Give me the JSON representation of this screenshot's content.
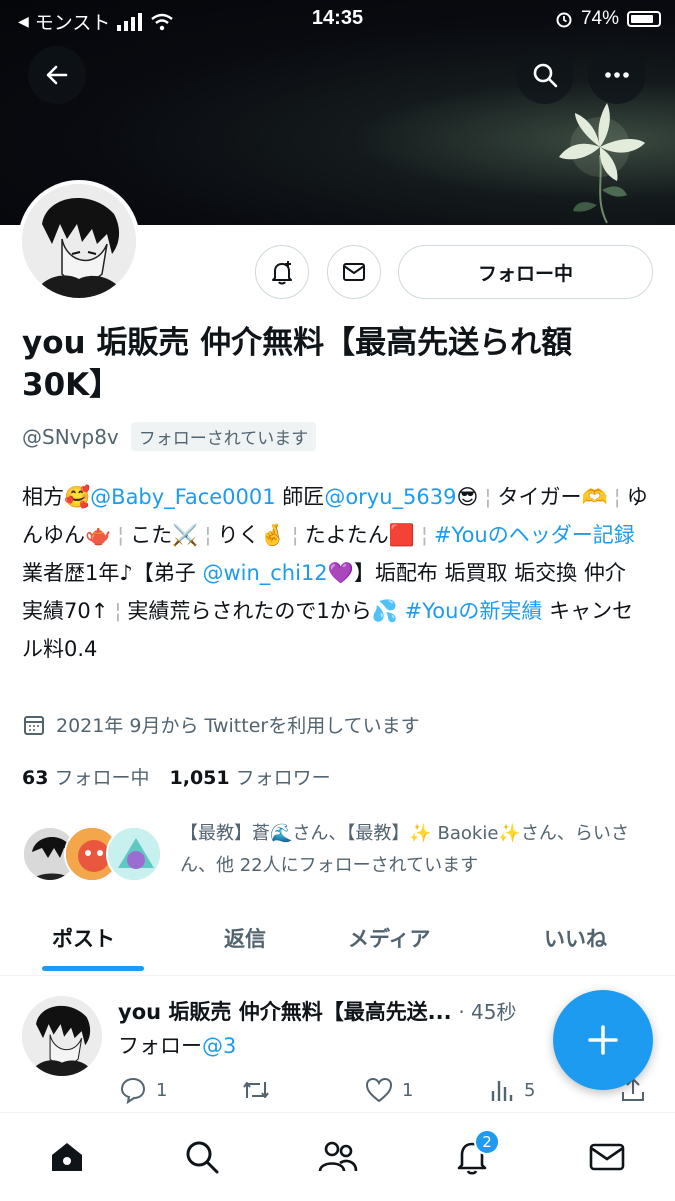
{
  "status_bar": {
    "carrier": "モンスト",
    "time": "14:35",
    "battery_percent": "74%",
    "battery_level": 0.74
  },
  "profile": {
    "name": "you 垢販売 仲介無料【最高先送られ額 30K】",
    "handle": "@SNvp8v",
    "follows_you": "フォローされています",
    "follow_button": "フォロー中",
    "joined": "2021年 9月から Twitterを利用しています",
    "following_count": "63",
    "following_label": "フォロー中",
    "followers_count": "1,051",
    "followers_label": "フォロワー",
    "known_followers": "【最教】蒼🌊さん、【最教】✨ Baokie✨さん、らいさん、他 22人にフォローされています"
  },
  "bio": {
    "t1": "相方🥰",
    "m1": "@Baby_Face0001",
    "t2": " 師匠",
    "m2": "@oryu_5639",
    "t3": "😎",
    "t4": "タイガー🫶",
    "t5": "ゆんゆん🫖",
    "t6": "こた⚔️",
    "t7": "りく🤞",
    "t8": "たよたん🟥",
    "h1": "#Youのヘッダー記録",
    "t9": " 業者歴1年♪【弟子 ",
    "m3": "@win_chi12",
    "t10": "💜】垢配布 垢買取 垢交換 仲介 実績70↑",
    "t11": "実績荒らされたので1から💦 ",
    "h2": "#Youの新実績",
    "t12": " キャンセル料0.4"
  },
  "tabs": [
    "ポスト",
    "返信",
    "メディア",
    "いいね"
  ],
  "post": {
    "author": "you 垢販売 仲介無料【最高先送...",
    "time": "· 45秒",
    "body_text": "フォロー",
    "body_mention": "@3",
    "replies": "1",
    "likes": "1",
    "views": "5"
  },
  "nav": {
    "notification_badge": "2"
  },
  "colors": {
    "accent": "#1d9bf0",
    "text": "#0f1419",
    "secondary": "#536471"
  }
}
